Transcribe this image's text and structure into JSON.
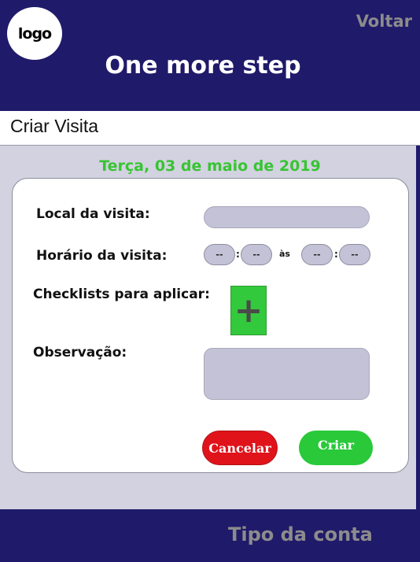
{
  "header": {
    "logo": "logo",
    "back_label": "Voltar",
    "title": "One more step"
  },
  "section": {
    "title": "Criar Visita"
  },
  "date": "Terça, 03 de maio de 2019",
  "form": {
    "local_label": "Local da visita:",
    "local_value": "",
    "horario_label": "Horário da visita:",
    "time_start_hour": "--",
    "time_start_minute": "--",
    "time_separator": ":",
    "time_between": "às",
    "time_end_hour": "--",
    "time_end_minute": "--",
    "checklists_label": "Checklists para aplicar:",
    "add_checklist_icon": "plus-icon",
    "add_glyph": "+",
    "observacao_label": "Observação:",
    "observacao_value": ""
  },
  "actions": {
    "cancel_label": "Cancelar",
    "create_label": "Criar"
  },
  "footer": {
    "account_type": "Tipo da conta"
  },
  "colors": {
    "header_bg": "#201a6a",
    "background": "#d3d2e0",
    "date_green": "#38c433",
    "cancel_red": "#e0131b",
    "create_green": "#29c93a",
    "field_bg": "#c3c2d6"
  }
}
